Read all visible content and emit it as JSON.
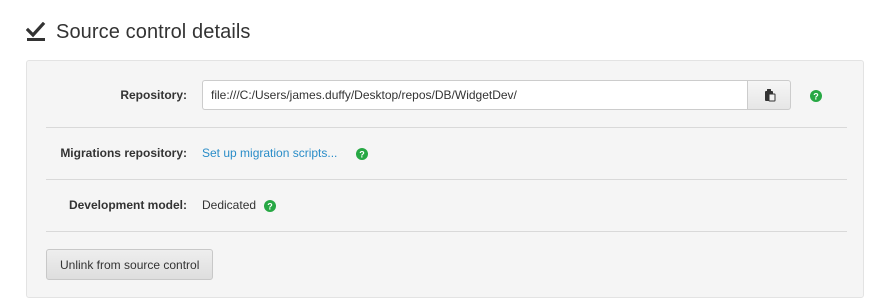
{
  "header": {
    "title": "Source control details",
    "icon": "checkmark-underline-icon"
  },
  "repository": {
    "label": "Repository:",
    "value": "file:///C:/Users/james.duffy/Desktop/repos/DB/WidgetDev/",
    "browse_icon": "browse-folder-icon"
  },
  "migrations": {
    "label": "Migrations repository:",
    "link_text": "Set up migration scripts..."
  },
  "development_model": {
    "label": "Development model:",
    "value": "Dedicated"
  },
  "actions": {
    "unlink_label": "Unlink from source control"
  },
  "colors": {
    "help_icon": "#27a844",
    "link": "#2a8dc8",
    "panel_bg": "#f5f5f5"
  }
}
